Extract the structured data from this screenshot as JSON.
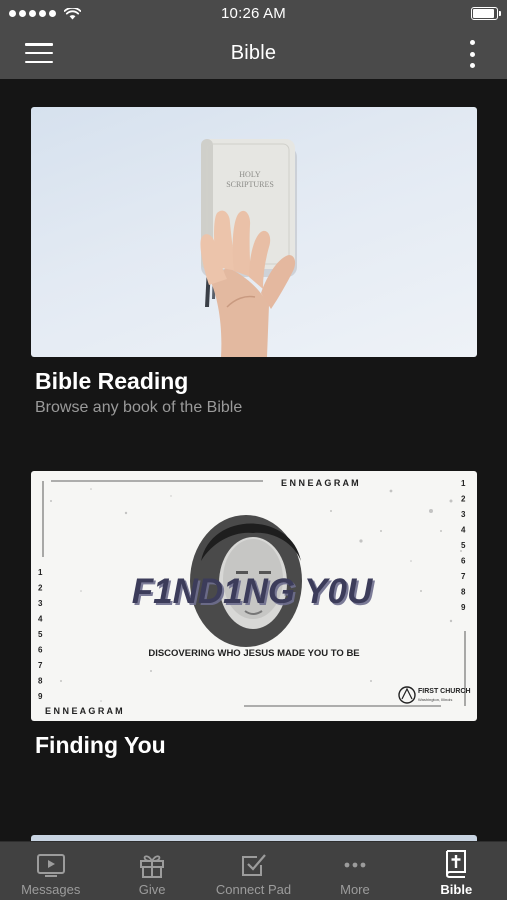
{
  "status_bar": {
    "time": "10:26 AM",
    "battery_level": 0.85
  },
  "nav_bar": {
    "title": "Bible"
  },
  "cards": [
    {
      "title": "Bible Reading",
      "subtitle": "Browse any book of the Bible",
      "image": {
        "book_text_line1": "HOLY",
        "book_text_line2": "SCRIPTURES"
      }
    },
    {
      "title": "Finding You",
      "image": {
        "headline": "F1ND1NG Y0U",
        "tagline": "DISCOVERING WHO JESUS MADE YOU TO BE",
        "top_word": "E N N E A G R A M",
        "bottom_word": "E N N E A G R A M",
        "numbers": [
          "1",
          "2",
          "3",
          "4",
          "5",
          "6",
          "7",
          "8",
          "9"
        ],
        "logo_line1": "FIRST CHURCH",
        "logo_line2": "Washington, Illinois"
      }
    }
  ],
  "tab_bar": {
    "tabs": [
      {
        "label": "Messages",
        "icon": "tv-play-icon",
        "active": false
      },
      {
        "label": "Give",
        "icon": "gift-icon",
        "active": false
      },
      {
        "label": "Connect Pad",
        "icon": "checkbox-icon",
        "active": false
      },
      {
        "label": "More",
        "icon": "more-dots-icon",
        "active": false
      },
      {
        "label": "Bible",
        "icon": "bible-cross-icon",
        "active": true
      }
    ]
  }
}
